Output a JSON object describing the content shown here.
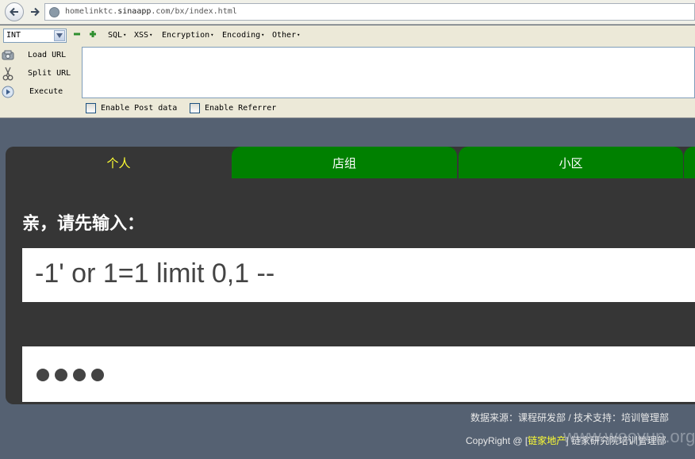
{
  "browser": {
    "url_host": "homelinktc.",
    "url_domain": "sinaapp",
    "url_path": ".com/bx/index.html"
  },
  "hackbar": {
    "type_select": "INT",
    "menus": [
      "SQL",
      "XSS",
      "Encryption",
      "Encoding",
      "Other"
    ],
    "load_url": "Load URL",
    "split_url": "Split URL",
    "execute": "Execute",
    "enable_post": "Enable Post data",
    "enable_referrer": "Enable Referrer"
  },
  "page": {
    "tabs": [
      "个人",
      "店组",
      "小区"
    ],
    "prompt": "亲，请先输入：",
    "username_value": "-1' or 1=1 limit 0,1 --",
    "password_mask": "●●●●",
    "footer_line1": "数据来源：课程研发部 / 技术支持：培训管理部",
    "footer_line2_prefix": "CopyRight @ [",
    "footer_line2_highlight": "链家地产",
    "footer_line2_suffix": "] 链家研究院培训管理部",
    "watermark": "www.wooyun.org"
  },
  "colors": {
    "tab_active_bg": "#363636",
    "tab_active_text": "#ffff33",
    "tab_inactive_bg": "#008000",
    "page_bg": "#556172"
  }
}
